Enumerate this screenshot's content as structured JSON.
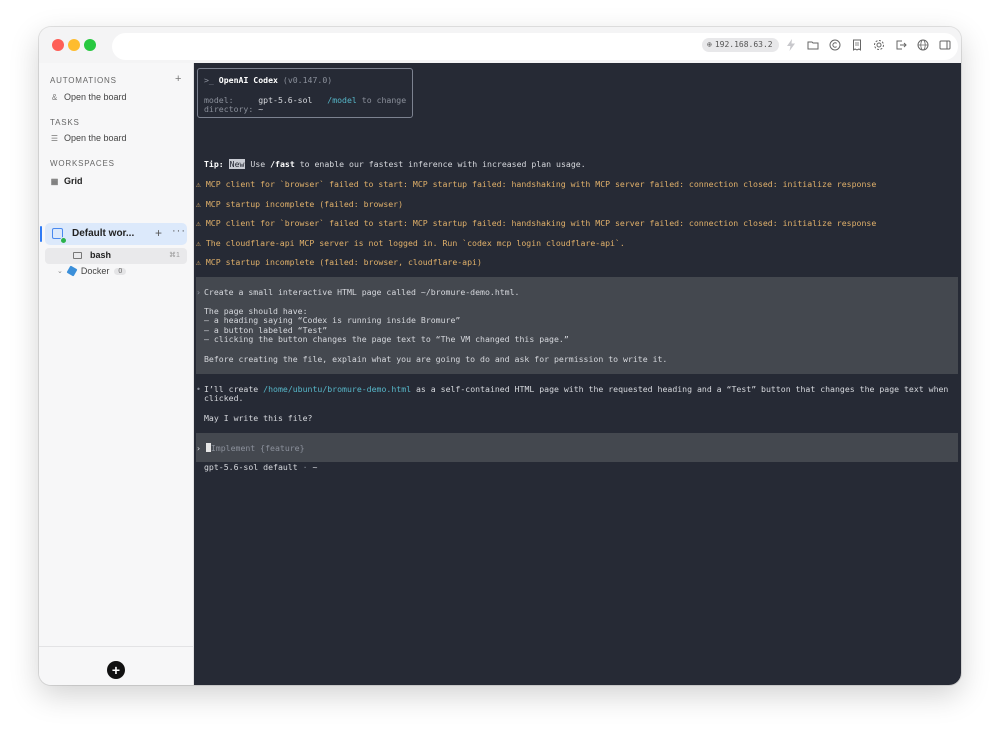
{
  "address": {
    "ip": "192.168.63.2"
  },
  "sidebar": {
    "automations": {
      "title": "AUTOMATIONS",
      "item": "Open the board",
      "add": "+"
    },
    "tasks": {
      "title": "TASKS",
      "item": "Open the board"
    },
    "workspaces": {
      "title": "WORKSPACES",
      "grid": "Grid",
      "workspace": {
        "label": "Default wor...",
        "add": "+",
        "more": "···"
      },
      "bash": {
        "label": "bash",
        "shortcut": "⌘1"
      },
      "docker": {
        "label": "Docker",
        "count": "0"
      }
    },
    "add_button": "+"
  },
  "terminal": {
    "header": {
      "prompt": ">_",
      "app": "OpenAI Codex",
      "version": "(v0.147.0)",
      "model_label": "model:",
      "model_value": "gpt-5.6-sol",
      "model_cmd": "/model",
      "model_hint": "to change",
      "dir_label": "directory:",
      "dir_value": "~"
    },
    "tip": {
      "label": "Tip:",
      "badge": "New",
      "pre": "Use",
      "cmd": "/fast",
      "text": "to enable our fastest inference with increased plan usage."
    },
    "warnings": [
      "⚠ MCP client for `browser` failed to start: MCP startup failed: handshaking with MCP server failed: connection closed: initialize response",
      "⚠ MCP startup incomplete (failed: browser)",
      "⚠ MCP client for `browser` failed to start: MCP startup failed: handshaking with MCP server failed: connection closed: initialize response",
      "⚠ The cloudflare-api MCP server is not logged in. Run `codex mcp login cloudflare-api`.",
      "⚠ MCP startup incomplete (failed: browser, cloudflare-api)"
    ],
    "user_prompt": {
      "marker": "›",
      "lines": [
        "Create a small interactive HTML page called ~/bromure-demo.html.",
        "",
        "The page should have:",
        "– a heading saying “Codex is running inside Bromure”",
        "– a button labeled “Test”",
        "– clicking the button changes the page text to “The VM changed this page.”",
        "",
        "Before creating the file, explain what you are going to do and ask for permission to write it."
      ]
    },
    "assistant": {
      "marker": "•",
      "pre": "I’ll create",
      "path": "/home/ubuntu/bromure-demo.html",
      "post": "as a self-contained HTML page with the requested heading and a “Test” button that changes the page text when",
      "cont": "clicked.",
      "question": "May I write this file?"
    },
    "input": {
      "marker": "›",
      "placeholder": "Implement {feature}"
    },
    "status": {
      "model": "gpt-5.6-sol default",
      "sep": "·",
      "dir": "~"
    }
  }
}
